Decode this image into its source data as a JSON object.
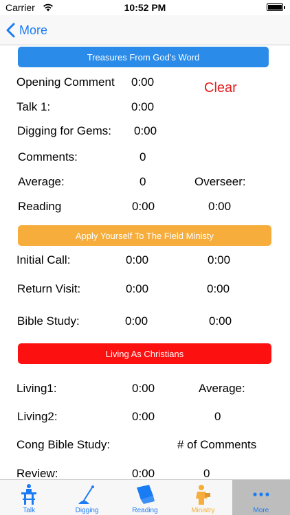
{
  "status_bar": {
    "carrier": "Carrier",
    "time": "10:52 PM"
  },
  "nav": {
    "back_label": "More"
  },
  "sections": {
    "treasures": "Treasures From God's Word",
    "apply": "Apply Yourself To The Field Ministy",
    "living": "Living As Christians"
  },
  "clear_label": "Clear",
  "rows": {
    "opening_label": "Opening Comment",
    "opening_time": "0:00",
    "talk1_label": "Talk 1:",
    "talk1_time": "0:00",
    "digging_label": "Digging for Gems:",
    "digging_time": "0:00",
    "comments_label": "Comments:",
    "comments_value": "0",
    "average_label": "Average:",
    "average_value": "0",
    "overseer_label": "Overseer:",
    "reading_label": "Reading",
    "reading_time1": "0:00",
    "reading_time2": "0:00",
    "initial_label": "Initial Call:",
    "initial_time1": "0:00",
    "initial_time2": "0:00",
    "return_label": "Return Visit:",
    "return_time1": "0:00",
    "return_time2": "0:00",
    "bible_label": "Bible Study:",
    "bible_time1": "0:00",
    "bible_time2": "0:00",
    "living1_label": "Living1:",
    "living1_time": "0:00",
    "average2_label": "Average:",
    "living2_label": "Living2:",
    "living2_time": "0:00",
    "living2_value": "0",
    "cong_label": "Cong Bible Study:",
    "num_comments_label": "# of Comments",
    "review_label": "Review:",
    "review_time": "0:00",
    "review_value": "0"
  },
  "tabs": [
    {
      "label": "Talk",
      "icon": "podium-icon"
    },
    {
      "label": "Digging",
      "icon": "shovel-icon"
    },
    {
      "label": "Reading",
      "icon": "book-reader-icon"
    },
    {
      "label": "Ministry",
      "icon": "ministry-icon"
    },
    {
      "label": "More",
      "icon": "more-dots-icon"
    }
  ],
  "colors": {
    "blue_banner": "#2a8be8",
    "orange_banner": "#f6ad3c",
    "red_banner": "#fc1010",
    "clear": "#e21e1e",
    "tint": "#1a7cf5"
  }
}
